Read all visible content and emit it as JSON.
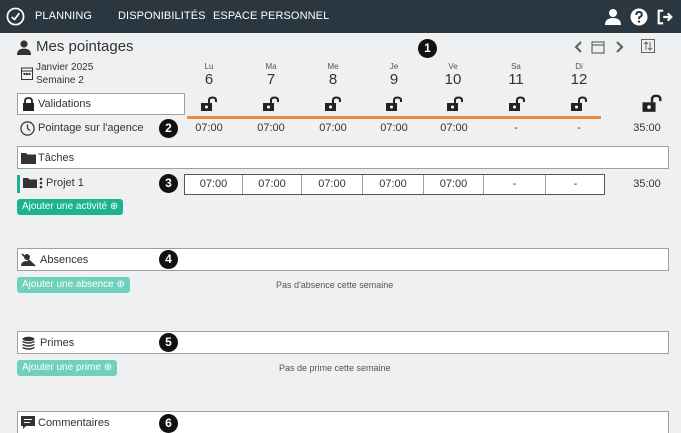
{
  "nav": {
    "planning": "PLANNING",
    "disponibilites": "DISPONIBILITÉS",
    "espace_personnel": "ESPACE PERSONNEL",
    "icons": [
      "clock-logo-icon",
      "user-icon",
      "help-icon",
      "logout-icon"
    ]
  },
  "header": {
    "title": "Mes pointages",
    "month": "Janvier 2025",
    "week": "Semaine 2"
  },
  "days": [
    {
      "name": "Lu",
      "num": "6"
    },
    {
      "name": "Ma",
      "num": "7"
    },
    {
      "name": "Me",
      "num": "8"
    },
    {
      "name": "Je",
      "num": "9"
    },
    {
      "name": "Ve",
      "num": "10"
    },
    {
      "name": "Sa",
      "num": "11"
    },
    {
      "name": "Di",
      "num": "12"
    }
  ],
  "validations": {
    "label": "Validations"
  },
  "agency": {
    "label": "Pointage sur l'agence",
    "values": [
      "07:00",
      "07:00",
      "07:00",
      "07:00",
      "07:00",
      "-",
      "-"
    ],
    "total": "35:00"
  },
  "tasks": {
    "label": "Tâches",
    "project": {
      "label": "Projet 1",
      "values": [
        "07:00",
        "07:00",
        "07:00",
        "07:00",
        "07:00",
        "-",
        "-"
      ],
      "total": "35:00"
    },
    "add_button": "Ajouter une activité"
  },
  "absences": {
    "label": "Absences",
    "add_button": "Ajouter une absence",
    "empty": "Pas d'absence cette semaine"
  },
  "primes": {
    "label": "Primes",
    "add_button": "Ajouter une prime",
    "empty": "Pas de prime cette semaine"
  },
  "commentaires": {
    "label": "Commentaires"
  },
  "badges": [
    "1",
    "2",
    "3",
    "4",
    "5",
    "6"
  ],
  "colors": {
    "topbar": "#2b3740",
    "accent_green": "#1bb48f",
    "validation_line": "#ec8a3c"
  }
}
